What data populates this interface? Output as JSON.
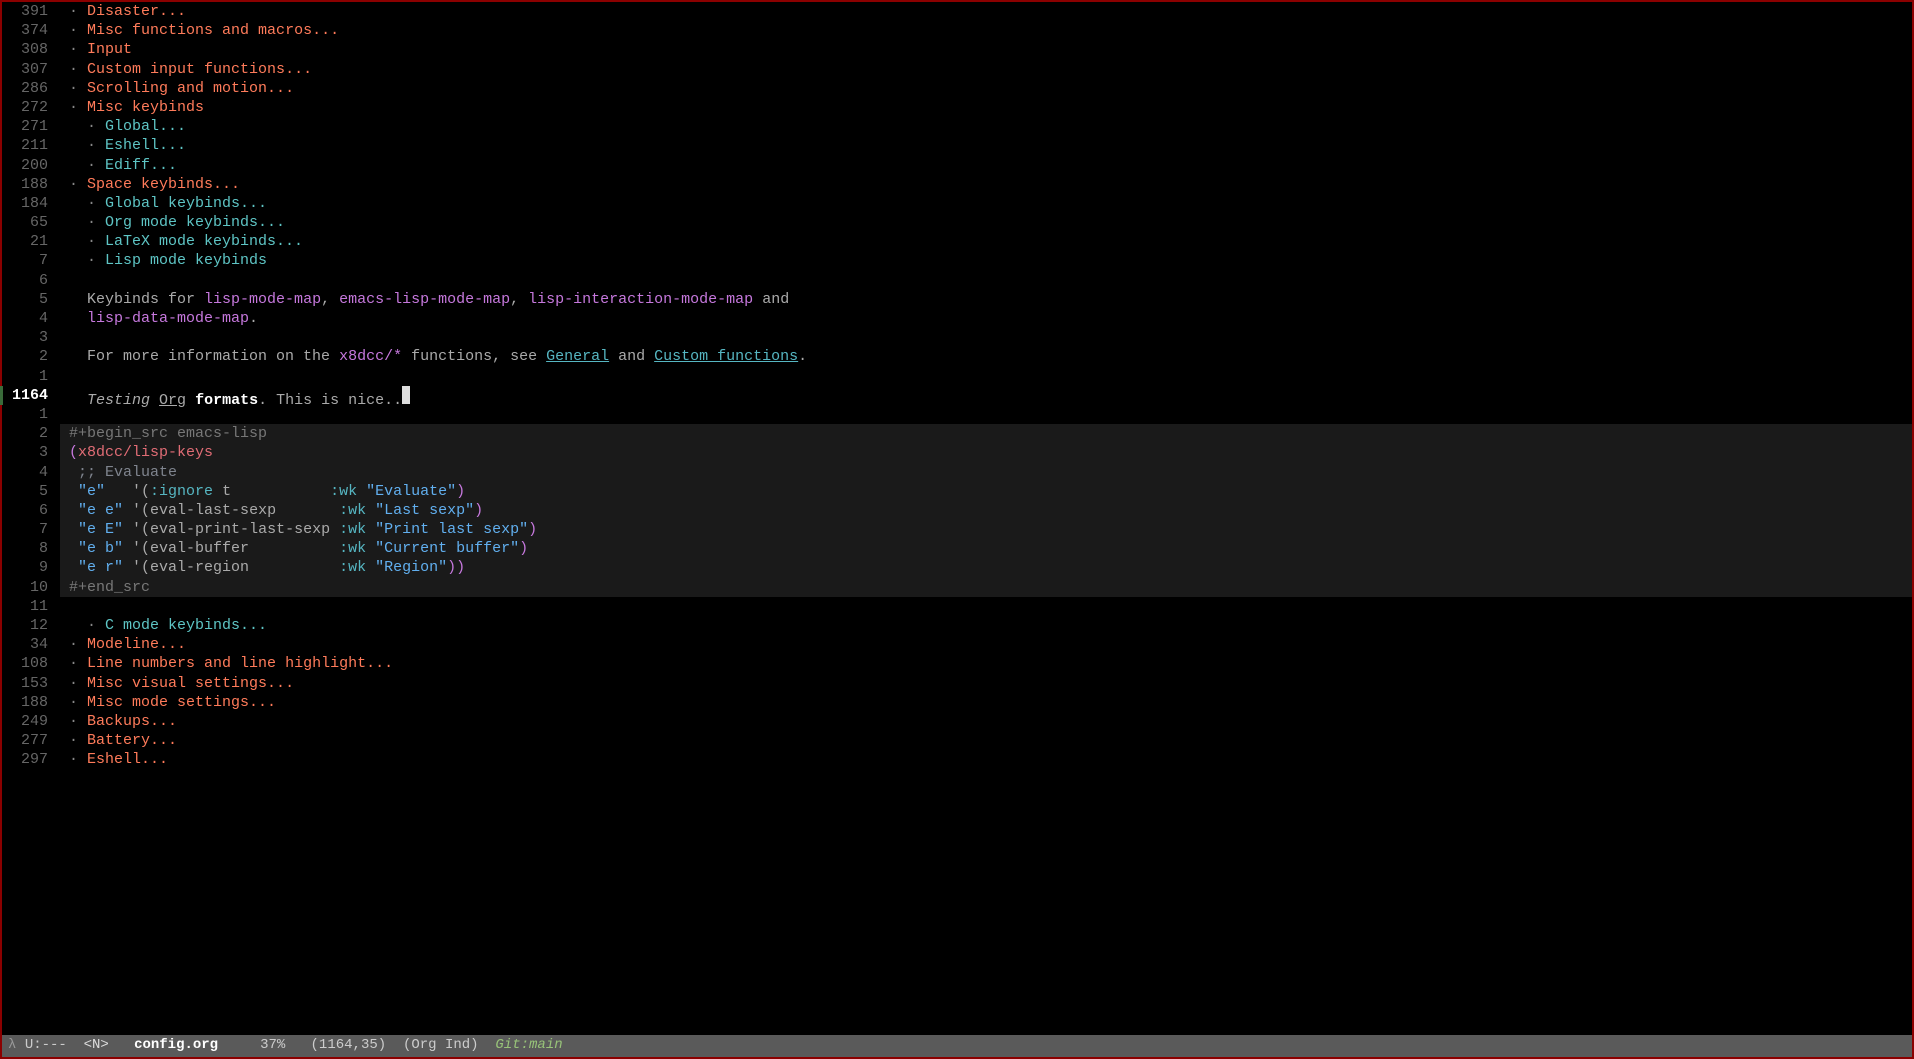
{
  "lines": [
    {
      "num": "391",
      "type": "h1",
      "bullet": "· ",
      "text": "Disaster...",
      "indent": 0
    },
    {
      "num": "374",
      "type": "h1",
      "bullet": "· ",
      "text": "Misc functions and macros...",
      "indent": 0
    },
    {
      "num": "308",
      "type": "h1",
      "bullet": "· ",
      "text": "Input",
      "indent": 0
    },
    {
      "num": "307",
      "type": "h1",
      "bullet": "· ",
      "text": "Custom input functions...",
      "indent": 0
    },
    {
      "num": "286",
      "type": "h1",
      "bullet": "· ",
      "text": "Scrolling and motion...",
      "indent": 0
    },
    {
      "num": "272",
      "type": "h1",
      "bullet": "· ",
      "text": "Misc keybinds",
      "indent": 0
    },
    {
      "num": "271",
      "type": "h2",
      "bullet": "· ",
      "text": "Global...",
      "indent": 1
    },
    {
      "num": "211",
      "type": "h2",
      "bullet": "· ",
      "text": "Eshell...",
      "indent": 1
    },
    {
      "num": "200",
      "type": "h2",
      "bullet": "· ",
      "text": "Ediff...",
      "indent": 1
    },
    {
      "num": "188",
      "type": "h1",
      "bullet": "· ",
      "text": "Space keybinds...",
      "indent": 0
    },
    {
      "num": "184",
      "type": "h2",
      "bullet": "· ",
      "text": "Global keybinds...",
      "indent": 1
    },
    {
      "num": "65",
      "type": "h2",
      "bullet": "· ",
      "text": "Org mode keybinds...",
      "indent": 1
    },
    {
      "num": "21",
      "type": "h2",
      "bullet": "· ",
      "text": "LaTeX mode keybinds...",
      "indent": 1
    },
    {
      "num": "7",
      "type": "h2",
      "bullet": "· ",
      "text": "Lisp mode keybinds",
      "indent": 1
    },
    {
      "num": "6",
      "type": "blank",
      "indent": 0
    },
    {
      "num": "5",
      "type": "para1",
      "indent": 1
    },
    {
      "num": "4",
      "type": "para2",
      "indent": 1
    },
    {
      "num": "3",
      "type": "blank",
      "indent": 0
    },
    {
      "num": "2",
      "type": "para3",
      "indent": 1
    },
    {
      "num": "1",
      "type": "blank",
      "indent": 0
    },
    {
      "num": "1164",
      "type": "cursor",
      "indent": 1,
      "current": true
    },
    {
      "num": "1",
      "type": "blank",
      "indent": 0
    },
    {
      "num": "2",
      "type": "srcbegin",
      "indent": 1
    },
    {
      "num": "3",
      "type": "code1",
      "indent": 1
    },
    {
      "num": "4",
      "type": "code2",
      "indent": 1
    },
    {
      "num": "5",
      "type": "code3",
      "indent": 1
    },
    {
      "num": "6",
      "type": "code4",
      "indent": 1
    },
    {
      "num": "7",
      "type": "code5",
      "indent": 1
    },
    {
      "num": "8",
      "type": "code6",
      "indent": 1
    },
    {
      "num": "9",
      "type": "code7",
      "indent": 1
    },
    {
      "num": "10",
      "type": "srcend",
      "indent": 1
    },
    {
      "num": "11",
      "type": "blank",
      "indent": 0
    },
    {
      "num": "12",
      "type": "h2",
      "bullet": "· ",
      "text": "C mode keybinds...",
      "indent": 1
    },
    {
      "num": "34",
      "type": "h1",
      "bullet": "· ",
      "text": "Modeline...",
      "indent": 0
    },
    {
      "num": "108",
      "type": "h1",
      "bullet": "· ",
      "text": "Line numbers and line highlight...",
      "indent": 0
    },
    {
      "num": "153",
      "type": "h1",
      "bullet": "· ",
      "text": "Misc visual settings...",
      "indent": 0
    },
    {
      "num": "188",
      "type": "h1",
      "bullet": "· ",
      "text": "Misc mode settings...",
      "indent": 0
    },
    {
      "num": "249",
      "type": "h1",
      "bullet": "· ",
      "text": "Backups...",
      "indent": 0
    },
    {
      "num": "277",
      "type": "h1",
      "bullet": "· ",
      "text": "Battery...",
      "indent": 0
    },
    {
      "num": "297",
      "type": "h1",
      "bullet": "· ",
      "text": "Eshell...",
      "indent": 0
    }
  ],
  "para1": {
    "pre": "Keybinds for ",
    "k1": "lisp-mode-map",
    "c1": ", ",
    "k2": "emacs-lisp-mode-map",
    "c2": ", ",
    "k3": "lisp-interaction-mode-map",
    "post": " and"
  },
  "para2": {
    "k4": "lisp-data-mode-map",
    "post": "."
  },
  "para3": {
    "pre": "For more information on the ",
    "fn": "x8dcc/*",
    "mid": " functions, see ",
    "l1": "General",
    "and": " and ",
    "l2": "Custom functions",
    "post": "."
  },
  "cursor_line": {
    "w1": "Testing",
    "sp1": " ",
    "w2": "Org",
    "sp2": " ",
    "w3": "formats",
    "post": ". This is nice.."
  },
  "src": {
    "begin": "#+begin_src emacs-lisp",
    "end": "#+end_src",
    "c1_open": "(",
    "c1_fn": "x8dcc/lisp-keys",
    "c2": " ;; Evaluate",
    "c3_k": "\"e\"",
    "c3_q": "   '(",
    "c3_i": ":ignore",
    "c3_t": " t",
    "c3_pad": "           ",
    "c3_wk": ":wk",
    "c3_s": " \"Evaluate\"",
    "c3_cl": ")",
    "c4_k": "\"e e\"",
    "c4_q": " '(",
    "c4_fn": "eval-last-sexp",
    "c4_pad": "       ",
    "c4_wk": ":wk",
    "c4_s": " \"Last sexp\"",
    "c4_cl": ")",
    "c5_k": "\"e E\"",
    "c5_q": " '(",
    "c5_fn": "eval-print-last-sexp",
    "c5_pad": " ",
    "c5_wk": ":wk",
    "c5_s": " \"Print last sexp\"",
    "c5_cl": ")",
    "c6_k": "\"e b\"",
    "c6_q": " '(",
    "c6_fn": "eval-buffer",
    "c6_pad": "          ",
    "c6_wk": ":wk",
    "c6_s": " \"Current buffer\"",
    "c6_cl": ")",
    "c7_k": "\"e r\"",
    "c7_q": " '(",
    "c7_fn": "eval-region",
    "c7_pad": "          ",
    "c7_wk": ":wk",
    "c7_s": " \"Region\"",
    "c7_cl": "))"
  },
  "modeline": {
    "lambda": "λ ",
    "status": "U:---  ",
    "evil": "<N>",
    "sep": "   ",
    "file": "config.org",
    "sep2": "     ",
    "pct": "37%",
    "sep3": "   ",
    "pos": "(1164,35)",
    "sep4": "  ",
    "mode": "(Org Ind)",
    "sep5": "  ",
    "git": "Git:main"
  }
}
